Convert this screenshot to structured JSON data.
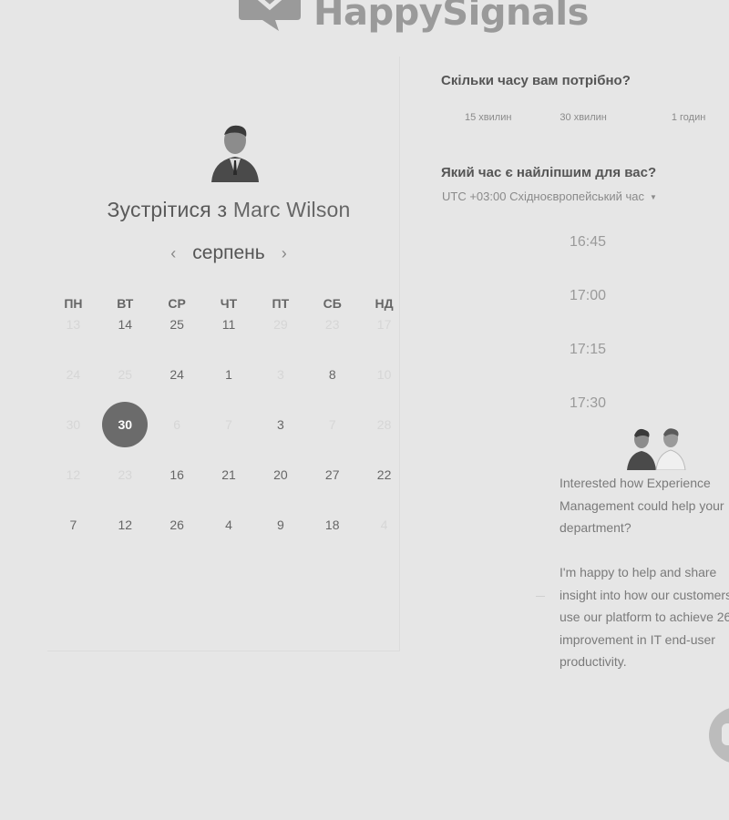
{
  "brand": {
    "name": "HappySignals"
  },
  "calendar": {
    "title_prefix": "Зустрітися з",
    "host_name": "Marc Wilson",
    "month": "серпень",
    "prev_icon": "chevron-left-icon",
    "next_icon": "chevron-right-icon",
    "weekdays": [
      "ПН",
      "ВТ",
      "СР",
      "ЧТ",
      "ПТ",
      "СБ",
      "НД"
    ],
    "weeks": [
      [
        {
          "d": "13",
          "m": true
        },
        {
          "d": "14",
          "m": false
        },
        {
          "d": "25",
          "m": false
        },
        {
          "d": "11",
          "m": false
        },
        {
          "d": "29",
          "m": true
        },
        {
          "d": "23",
          "m": true
        },
        {
          "d": "17",
          "m": true
        }
      ],
      [
        {
          "d": "24",
          "m": true
        },
        {
          "d": "25",
          "m": true
        },
        {
          "d": "24",
          "m": false
        },
        {
          "d": "1",
          "m": false
        },
        {
          "d": "3",
          "m": true
        },
        {
          "d": "8",
          "m": false
        },
        {
          "d": "10",
          "m": true
        }
      ],
      [
        {
          "d": "30",
          "m": true
        },
        {
          "d": "30",
          "m": false,
          "sel": true
        },
        {
          "d": "6",
          "m": true
        },
        {
          "d": "7",
          "m": true
        },
        {
          "d": "3",
          "m": false
        },
        {
          "d": "7",
          "m": true
        },
        {
          "d": "28",
          "m": true
        }
      ],
      [
        {
          "d": "12",
          "m": true
        },
        {
          "d": "23",
          "m": true
        },
        {
          "d": "16",
          "m": false
        },
        {
          "d": "21",
          "m": false
        },
        {
          "d": "20",
          "m": false
        },
        {
          "d": "27",
          "m": false
        },
        {
          "d": "22",
          "m": false
        }
      ],
      [
        {
          "d": "7",
          "m": false
        },
        {
          "d": "12",
          "m": false
        },
        {
          "d": "26",
          "m": false
        },
        {
          "d": "4",
          "m": false
        },
        {
          "d": "9",
          "m": false
        },
        {
          "d": "18",
          "m": false
        },
        {
          "d": "4",
          "m": true
        }
      ]
    ]
  },
  "booking": {
    "duration_question": "Скільки часу вам потрібно?",
    "durations": [
      "15 хвилин",
      "30 хвилин",
      "1 годин"
    ],
    "time_question": "Який час є найліпшим для вас?",
    "timezone": "UTC +03:00 Східноєвропейський час",
    "slots": [
      "16:45",
      "17:00",
      "17:15",
      "17:30"
    ]
  },
  "chat": {
    "message_1_lines": [
      "Interested how Experience",
      "Management could help your",
      "department?"
    ],
    "message_2_lines": [
      "I'm happy to help and share",
      "insight into how our customers",
      "use our platform to achieve 26",
      "improvement in IT end-user",
      "productivity."
    ]
  },
  "colors": {
    "background": "#e6e6e6",
    "selected_day": "#6b6b6b"
  }
}
